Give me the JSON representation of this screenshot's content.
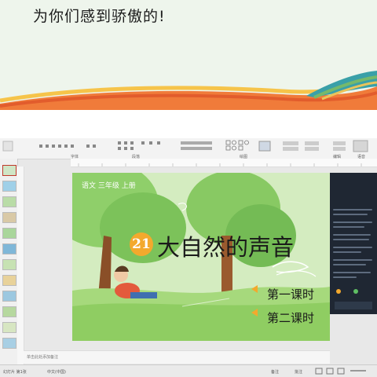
{
  "banner": {
    "text": "为你们感到骄傲的!"
  },
  "ribbon": {
    "groups": [
      "字体",
      "段落",
      "绘图",
      "编辑",
      "语音"
    ]
  },
  "slide": {
    "header": "语文  三年级  上册",
    "lesson_number": "21",
    "title": "大自然的声音",
    "lessons": [
      "第一课时",
      "第二课时"
    ]
  },
  "status": {
    "notes_placeholder": "单击此处添加备注",
    "slide_info": "幻灯片 第1张",
    "language": "中文(中国)",
    "notes_btn": "备注",
    "comments_btn": "批注"
  },
  "colors": {
    "badge": "#f3a92d",
    "panel": "#1f2733",
    "ribbon": "#f3f3f3"
  }
}
